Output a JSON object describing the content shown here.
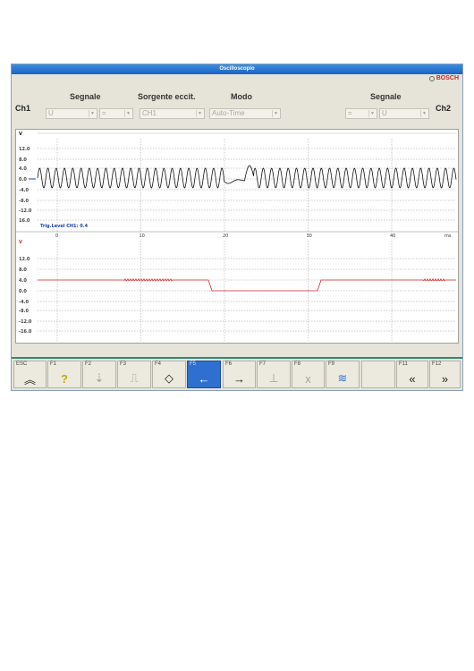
{
  "window": {
    "title": "Oscilloscopio",
    "brand": "BOSCH"
  },
  "channels": {
    "ch1": "Ch1",
    "ch2": "Ch2"
  },
  "headers": {
    "segnale_left": "Segnale",
    "sorgente": "Sorgente eccit.",
    "modo": "Modo",
    "segnale_right": "Segnale"
  },
  "combos": {
    "ch1_signal": "U",
    "ch1_op": "=",
    "source": "CH1",
    "mode": "Auto-Time",
    "ch2_op": "=",
    "ch2_signal": "U"
  },
  "plot": {
    "unit_top": "V",
    "unit_bottom": "V",
    "trigger_text": "Trig.Level CH1:  0.4",
    "time_unit": "ms",
    "y_ticks_top": [
      "12.0",
      "8.0",
      "4.0",
      "0.0",
      "-4.0",
      "-8.0",
      "-12.0",
      "16.0"
    ],
    "y_ticks_bottom": [
      "12.0",
      "8.0",
      "4.0",
      "0.0",
      "-4.0",
      "-8.0",
      "-12.0",
      "-16.0"
    ],
    "x_ticks": [
      "0",
      "10",
      "20",
      "30",
      "40"
    ],
    "trace_top_color": "#111111",
    "trace_bottom_color": "#d42a2a"
  },
  "fkeys": [
    {
      "label": "ESC",
      "icon": "double-up-chevron-icon",
      "glyph": "︽"
    },
    {
      "label": "F1",
      "icon": "help-person-icon",
      "glyph": "?"
    },
    {
      "label": "F2",
      "icon": "cursor-down-icon",
      "glyph": "⇣"
    },
    {
      "label": "F3",
      "icon": "trigger-edge-icon",
      "glyph": "⎍"
    },
    {
      "label": "F4",
      "icon": "diamond-icon",
      "glyph": "◇"
    },
    {
      "label": "F5",
      "icon": "arrow-left-icon",
      "glyph": "←"
    },
    {
      "label": "F6",
      "icon": "arrow-right-icon",
      "glyph": "→"
    },
    {
      "label": "F7",
      "icon": "cursor-measure-icon",
      "glyph": "⊥"
    },
    {
      "label": "F8",
      "icon": "x-axis-icon",
      "glyph": "x"
    },
    {
      "label": "F9",
      "icon": "waveform-icon",
      "glyph": "≋"
    },
    {
      "label": "",
      "icon": "blank-icon",
      "glyph": ""
    },
    {
      "label": "F11",
      "icon": "double-left-chevron-icon",
      "glyph": "«"
    },
    {
      "label": "F12",
      "icon": "double-right-chevron-icon",
      "glyph": "»"
    }
  ]
}
